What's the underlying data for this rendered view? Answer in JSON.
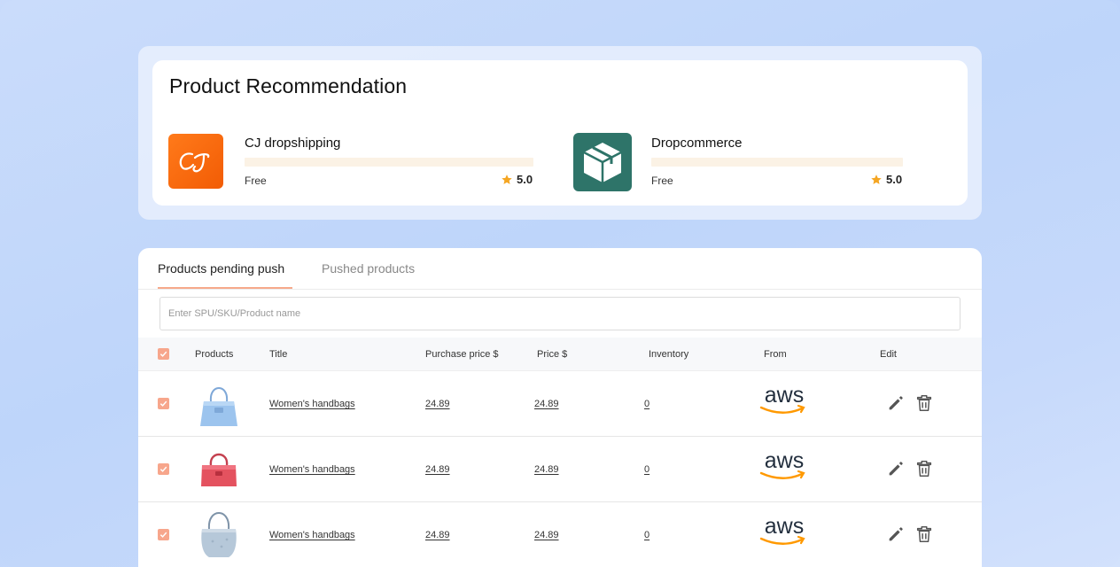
{
  "recommendation": {
    "title": "Product Recommendation",
    "apps": [
      {
        "name": "CJ dropshipping",
        "price": "Free",
        "rating": "5.0",
        "logo_text": "CJ",
        "logo_color": "#f2690f"
      },
      {
        "name": "Dropcommerce",
        "price": "Free",
        "rating": "5.0",
        "logo_icon": "box-icon",
        "logo_color": "#2e7469"
      }
    ]
  },
  "tabs": [
    {
      "label": "Products pending push",
      "active": true
    },
    {
      "label": "Pushed products",
      "active": false
    }
  ],
  "search": {
    "placeholder": "Enter SPU/SKU/Product name",
    "value": ""
  },
  "table": {
    "headers": [
      "Products",
      "Title",
      "Purchase price $",
      "Price $",
      "Inventory",
      "From",
      "Edit"
    ],
    "rows": [
      {
        "checked": true,
        "image": "blue-handbag",
        "title": "Women's handbags",
        "purchase_price": "24.89",
        "price": "24.89",
        "inventory": "0",
        "from": "aws"
      },
      {
        "checked": true,
        "image": "pink-handbag",
        "title": "Women's handbags",
        "purchase_price": "24.89",
        "price": "24.89",
        "inventory": "0",
        "from": "aws"
      },
      {
        "checked": true,
        "image": "silver-handbag",
        "title": "Women's handbags",
        "purchase_price": "24.89",
        "price": "24.89",
        "inventory": "0",
        "from": "aws"
      }
    ]
  },
  "colors": {
    "accent": "#f7a68c",
    "star": "#f5a623",
    "aws_text": "#232f3e",
    "aws_smile": "#ff9900"
  }
}
